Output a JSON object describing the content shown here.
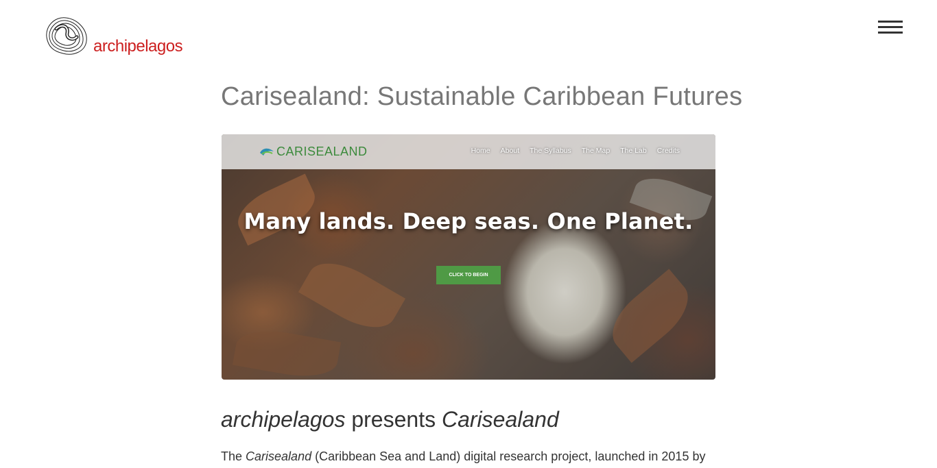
{
  "header": {
    "logo_text": "archipelagos",
    "menu_icon": "hamburger-icon"
  },
  "main": {
    "title": "Carisealand: Sustainable Caribbean Futures",
    "hero": {
      "logo_text": "CARISEALAND",
      "nav_links": [
        "Home",
        "About",
        "The Syllabus",
        "The Map",
        "The Lab",
        "Credits"
      ],
      "headline": "Many lands. Deep seas. One Planet.",
      "cta_label": "CLICK TO BEGIN"
    },
    "section": {
      "heading_part1": "archipelagos",
      "heading_part2": " presents ",
      "heading_part3": "Carisealand"
    },
    "paragraph": {
      "part1": "The ",
      "part2": "Carisealand",
      "part3": " (Caribbean Sea and Land) digital research project, launched in 2015 by"
    }
  },
  "colors": {
    "brand_red": "#cc1f1f",
    "cta_green": "#4f9a45",
    "title_gray": "#777777"
  }
}
